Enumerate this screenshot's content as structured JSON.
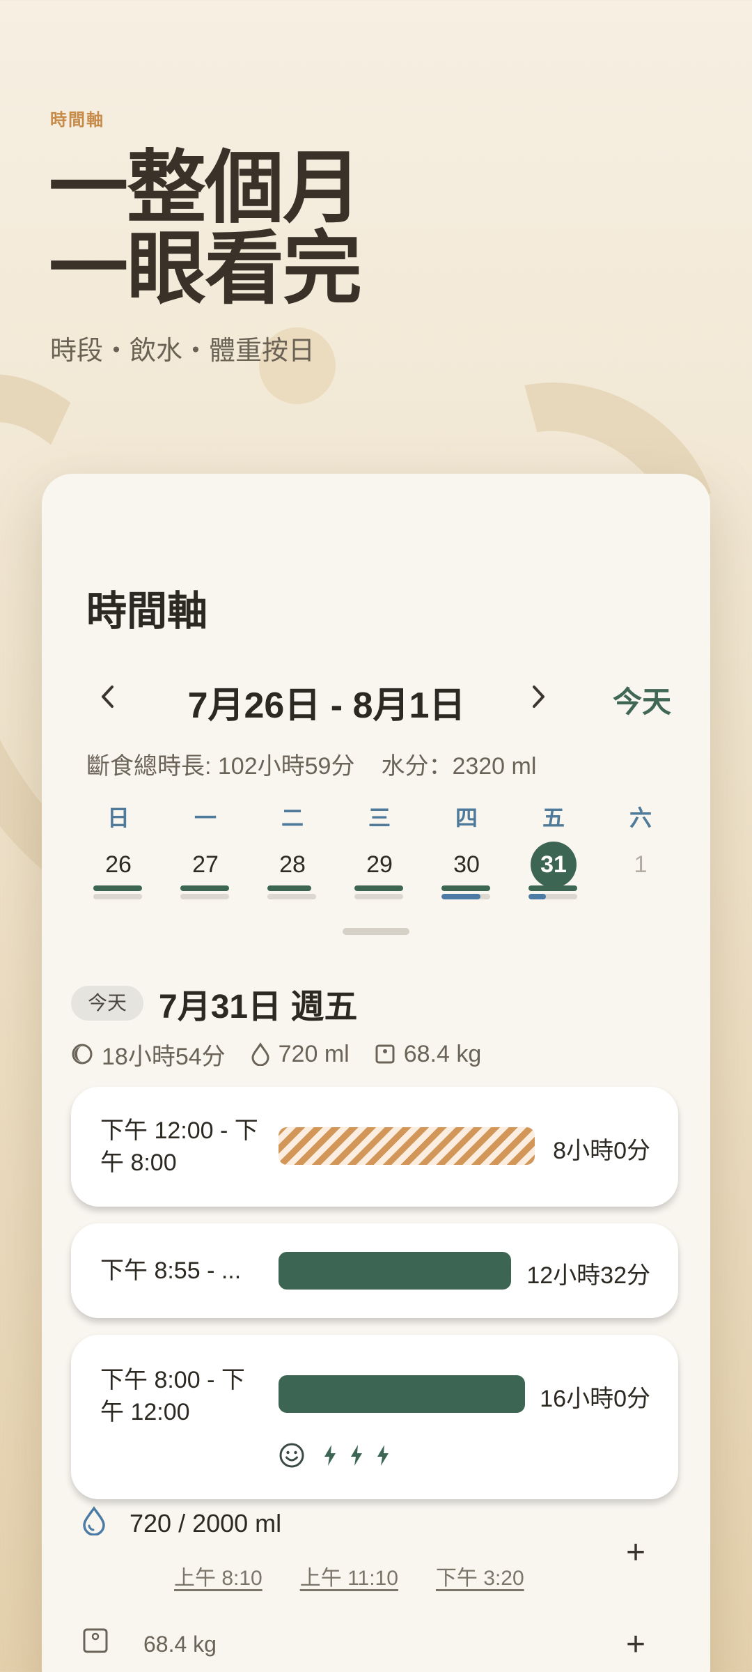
{
  "promo": {
    "eyebrow": "時間軸",
    "headline_line1": "一整個月",
    "headline_line2": "一眼看完",
    "subhead": "時段・飲水・體重按日"
  },
  "card": {
    "title": "時間軸",
    "nav": {
      "prev": "‹",
      "range": "7月26日 - 8月1日",
      "next": "›",
      "today": "今天"
    },
    "stats": {
      "fasting": "斷食總時長: 102小時59分",
      "water": "水分：2320 ml"
    },
    "week": [
      {
        "weekday": "日",
        "day": "26",
        "fast_progress": 1.0,
        "water_progress": 0.0
      },
      {
        "weekday": "一",
        "day": "27",
        "fast_progress": 1.0,
        "water_progress": 0.0
      },
      {
        "weekday": "二",
        "day": "28",
        "fast_progress": 0.9,
        "water_progress": 0.0
      },
      {
        "weekday": "三",
        "day": "29",
        "fast_progress": 1.0,
        "water_progress": 0.0
      },
      {
        "weekday": "四",
        "day": "30",
        "fast_progress": 1.0,
        "water_progress": 0.8
      },
      {
        "weekday": "五",
        "day": "31",
        "fast_progress": 1.0,
        "water_progress": 0.36,
        "selected": true
      },
      {
        "weekday": "六",
        "day": "1",
        "future": true
      }
    ],
    "selected_day": {
      "badge": "今天",
      "date": "7月31日 週五",
      "fasting": "18小時54分",
      "water": "720 ml",
      "weight": "68.4 kg"
    },
    "fasts": [
      {
        "time": "下午 12:00 - 下午 8:00",
        "duration": "8小時0分",
        "style": "hatched",
        "fill": 0.92
      },
      {
        "time": "下午 8:55 - ...",
        "duration": "12小時32分",
        "style": "solid",
        "fill": 0.83
      },
      {
        "time": "下午 8:00 - 下午 12:00",
        "duration": "16小時0分",
        "style": "solid",
        "fill": 0.88,
        "icons": [
          "smile-icon",
          "bolt-icon",
          "bolt-icon",
          "bolt-icon"
        ]
      }
    ],
    "water_log": {
      "value": "720 / 2000 ml",
      "times": [
        "上午 8:10",
        "上午 11:10",
        "下午 3:20"
      ],
      "add": "+"
    },
    "weight_log": {
      "value": "68.4 kg",
      "add": "+"
    }
  },
  "colors": {
    "accent_green": "#3d6553",
    "water_blue": "#4b7ba4",
    "orange": "#d29658"
  }
}
